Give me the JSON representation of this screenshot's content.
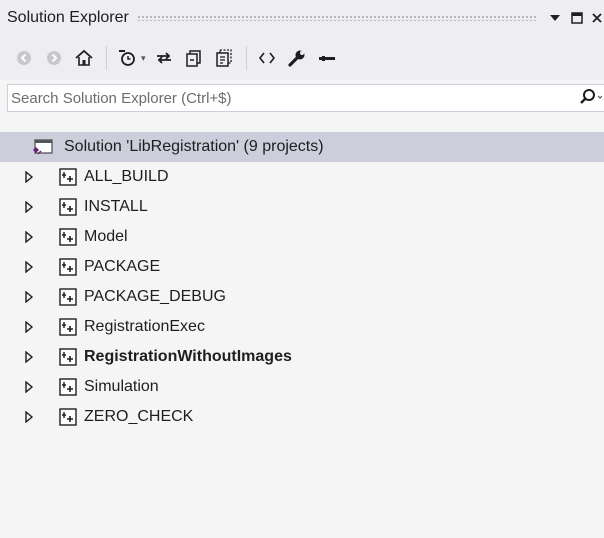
{
  "window": {
    "title": "Solution Explorer",
    "dropdown_icon": "dropdown-triangle-icon",
    "maximize_icon": "maximize-icon",
    "close_icon": "close-icon"
  },
  "toolbar": {
    "items": [
      "back-icon",
      "forward-icon",
      "home-icon",
      "pending-changes-filter-icon",
      "sync-active-document-icon",
      "collapse-all-icon",
      "show-all-files-icon",
      "view-code-icon",
      "properties-wrench-icon",
      "preview-selected-items-icon"
    ]
  },
  "search": {
    "placeholder": "Search Solution Explorer (Ctrl+$)"
  },
  "tree": {
    "solution": {
      "label": "Solution 'LibRegistration' (9 projects)"
    },
    "projects": [
      {
        "label": "ALL_BUILD",
        "bold": false
      },
      {
        "label": "INSTALL",
        "bold": false
      },
      {
        "label": "Model",
        "bold": false
      },
      {
        "label": "PACKAGE",
        "bold": false
      },
      {
        "label": "PACKAGE_DEBUG",
        "bold": false
      },
      {
        "label": "RegistrationExec",
        "bold": false
      },
      {
        "label": "RegistrationWithoutImages",
        "bold": true
      },
      {
        "label": "Simulation",
        "bold": false
      },
      {
        "label": "ZERO_CHECK",
        "bold": false
      }
    ]
  }
}
